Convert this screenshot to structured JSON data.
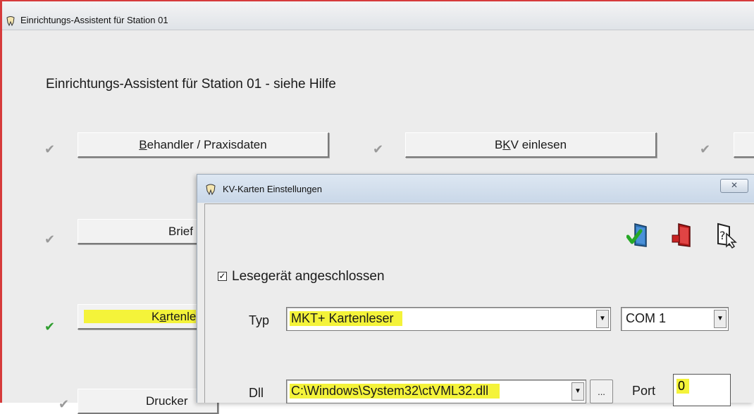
{
  "main_window": {
    "title": "Einrichtungs-Assistent für Station 01",
    "heading": "Einrichtungs-Assistent für Station  01 - siehe Hilfe",
    "buttons": {
      "behandler_pre": "",
      "behandler_ul": "B",
      "behandler_post": "ehandler / Praxisdaten",
      "bkv_pre": "B",
      "bkv_ul": "K",
      "bkv_post": "V einlesen",
      "brief": "Brief",
      "karten_pre": "K",
      "karten_ul": "a",
      "karten_post": "rtenle",
      "drucker": "Drucker"
    }
  },
  "dialog": {
    "title": "KV-Karten Einstellungen",
    "close_glyph": "☒",
    "reader_checkbox": {
      "checked": true,
      "mark": "✓",
      "label": "Lesegerät angeschlossen"
    },
    "typ": {
      "label": "Typ",
      "value": "MKT+ Kartenleser"
    },
    "com": {
      "value": "COM 1"
    },
    "dll": {
      "label": "Dll",
      "value": "C:\\Windows\\System32\\ctVML32.dll"
    },
    "browse_label": "...",
    "port": {
      "label": "Port",
      "value": "0"
    },
    "icons": [
      "door-accept-icon",
      "door-cancel-icon",
      "help-cursor-icon"
    ]
  },
  "colors": {
    "highlight": "#f4f33a",
    "check_done": "#2f9e2f",
    "check_pending": "#9a9a9a",
    "window_border": "#d63b3b"
  }
}
